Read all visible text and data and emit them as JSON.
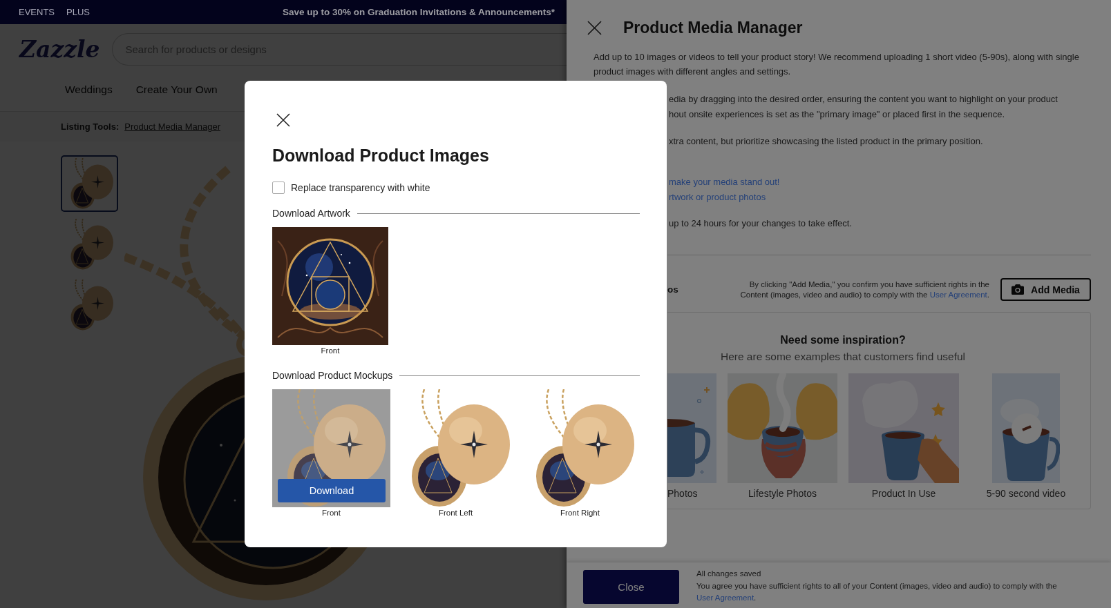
{
  "top_bar": {
    "links": [
      "EVENTS",
      "PLUS"
    ],
    "promo": "Save up to 30% on Graduation Invitations & Announcements*"
  },
  "header": {
    "logo": "Zazzle",
    "search": {
      "placeholder": "Search for products or designs"
    },
    "nav": [
      "Weddings",
      "Create Your Own"
    ]
  },
  "listing_tools": {
    "label": "Listing Tools:",
    "link": "Product Media Manager"
  },
  "gallery": {
    "thumbnails": [
      {
        "selected": true
      },
      {
        "selected": false
      },
      {
        "selected": false
      }
    ]
  },
  "media_manager": {
    "title": "Product Media Manager",
    "intro": "Add up to 10 images or videos to tell your product story! We recommend uploading 1 short video (5-90s), along with single product images with different angles and settings.",
    "partly_covered": [
      {
        "kind": "text",
        "lines": [
          "edia by dragging into the desired order, ensuring the content you want to highlight on your product",
          "hout onsite experiences is set as the \"primary image\" or placed first in the sequence."
        ]
      },
      {
        "kind": "text",
        "lines": [
          "xtra content, but prioritize showcasing the listed product in the primary position."
        ]
      },
      {
        "kind": "links",
        "lines": [
          "make your media stand out!",
          "rtwork or product photos"
        ]
      },
      {
        "kind": "text",
        "lines": [
          "up to 24 hours for your changes to take effect."
        ]
      }
    ],
    "add_media": {
      "section_label": "os",
      "notice": {
        "text": "By clicking \"Add Media,\" you confirm you have sufficient rights in the Content (images, video and audio) to comply with the",
        "link": "User Agreement",
        "after": "."
      },
      "button": "Add Media"
    },
    "inspiration": {
      "title": "Need some inspiration?",
      "subtitle": "Here are some examples that customers find useful",
      "examples": [
        {
          "kind": "mug",
          "label": "Photos"
        },
        {
          "kind": "hands",
          "label": "Lifestyle Photos"
        },
        {
          "kind": "hand",
          "label": "Product In Use"
        },
        {
          "kind": "video",
          "label": "5-90 second video"
        }
      ]
    },
    "footer": {
      "close_button": "Close",
      "status": "All changes saved",
      "agreement": {
        "text": "You agree you have sufficient rights to all of your Content (images, video and audio) to comply with the",
        "link": "User Agreement",
        "after": "."
      }
    }
  },
  "download_dialog": {
    "title": "Download Product Images",
    "replace_transparency": {
      "label": "Replace transparency with white",
      "checked": false
    },
    "artwork": {
      "heading": "Download Artwork",
      "items": [
        {
          "caption": "Front"
        }
      ]
    },
    "mockups": {
      "heading": "Download Product Mockups",
      "download_button": "Download",
      "items": [
        {
          "caption": "Front",
          "hovered": true
        },
        {
          "caption": "Front Left",
          "hovered": false
        },
        {
          "caption": "Front Right",
          "hovered": false
        }
      ]
    }
  }
}
